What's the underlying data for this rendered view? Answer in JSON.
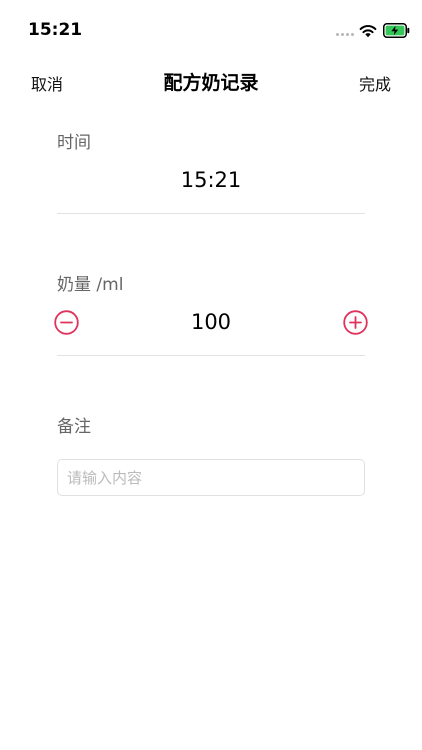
{
  "status_bar": {
    "time": "15:21"
  },
  "nav": {
    "cancel_label": "取消",
    "title": "配方奶记录",
    "done_label": "完成"
  },
  "time_section": {
    "label": "时间",
    "value": "15:21"
  },
  "amount_section": {
    "label": "奶量 /ml",
    "value": "100"
  },
  "note_section": {
    "label": "备注",
    "placeholder": "请输入内容",
    "value": ""
  },
  "colors": {
    "accent": "#e0325a",
    "battery": "#36c759",
    "label_text": "#666666",
    "divider": "#e3e3e3"
  },
  "icons": {
    "decrement": "minus-circle-icon",
    "increment": "plus-circle-icon",
    "wifi": "wifi-icon",
    "battery": "battery-charging-icon"
  }
}
